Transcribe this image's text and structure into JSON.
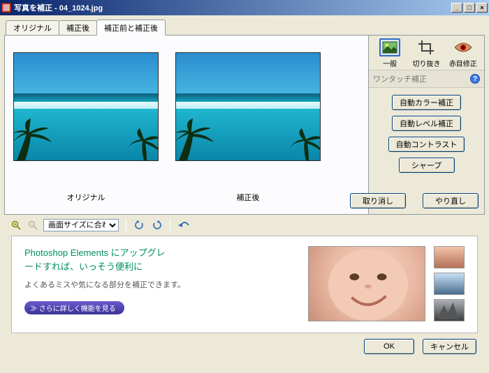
{
  "window": {
    "title": "写真を補正 - 04_1024.jpg"
  },
  "tabs": {
    "original": "オリジナル",
    "after": "補正後",
    "both": "補正前と補正後"
  },
  "captions": {
    "original": "オリジナル",
    "after": "補正後"
  },
  "modes": {
    "general": "一般",
    "crop": "切り抜き",
    "redeye": "赤目修正"
  },
  "side": {
    "title": "ワンタッチ補正",
    "auto_color": "自動カラー補正",
    "auto_level": "自動レベル補正",
    "auto_contrast": "自動コントラスト",
    "sharpen": "シャープ"
  },
  "buttons": {
    "undo": "取り消し",
    "redo": "やり直し",
    "ok": "OK",
    "cancel": "キャンセル"
  },
  "toolbar": {
    "zoom_label": "画面サイズに合わせる"
  },
  "promo": {
    "heading_l1": "Photoshop Elements にアップグレ",
    "heading_l2": "ードすれば、いっそう便利に",
    "body": "よくあるミスや気になる部分を補正できます。",
    "btn": "≫ さらに詳しく機能を見る"
  }
}
